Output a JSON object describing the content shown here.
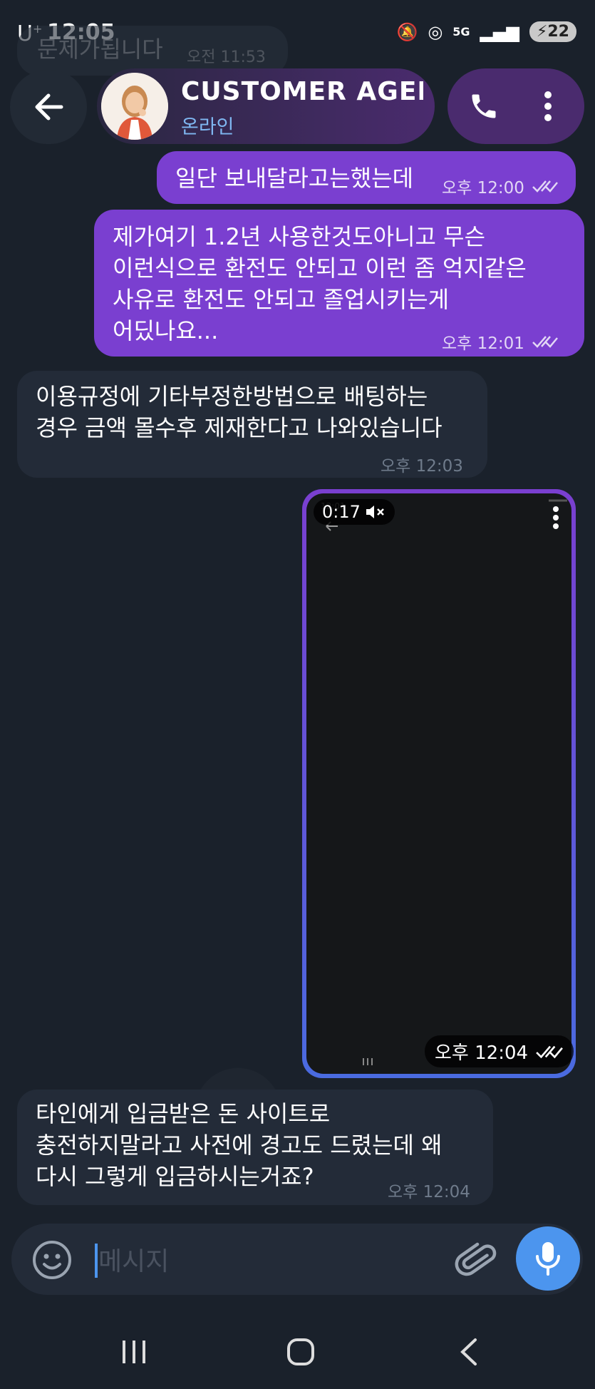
{
  "status_bar": {
    "carrier": "U",
    "carrier_sup": "+",
    "time": "12:05",
    "network": "5G",
    "battery": "22"
  },
  "previous_message": {
    "text": "문제가됩니다",
    "time": "오전 11:53"
  },
  "header": {
    "title": "CUSTOMER AGEN",
    "status": "온라인"
  },
  "messages": [
    {
      "text": "일단 보내달라고는했는데",
      "time": "오후 12:00"
    },
    {
      "text_lines": [
        "제가여기 1.2년 사용한것도아니고 무슨",
        "이런식으로 환전도 안되고 이런 좀 억지같은",
        "사유로 환전도 안되고 졸업시키는게",
        "어딨나요..."
      ],
      "time": "오후 12:01"
    },
    {
      "text_lines": [
        "이용규정에 기타부정한방법으로 배팅하는",
        "경우 금액 몰수후 제재한다고 나와있습니다"
      ],
      "time": "오후 12:03"
    },
    {
      "video_duration": "0:17",
      "time": "오후 12:04"
    },
    {
      "text_lines": [
        "타인에게 입금받은 돈 사이트로",
        "충전하지말라고 사전에 경고도 드렸는데 왜",
        "다시 그렇게 입금하시는거죠?"
      ],
      "time": "오후 12:04"
    }
  ],
  "composer": {
    "placeholder": "메시지"
  },
  "icons": {
    "back": "arrow-left-icon",
    "call": "phone-icon",
    "menu": "more-vertical-icon",
    "emoji": "emoji-icon",
    "attach": "paperclip-icon",
    "mic": "microphone-icon"
  }
}
